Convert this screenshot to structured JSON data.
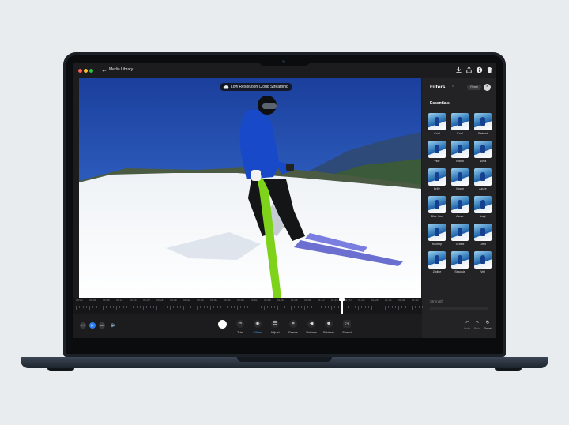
{
  "window": {
    "title": "Media Library"
  },
  "stream": {
    "label": "Low Resolution Cloud Streaming"
  },
  "filters_panel": {
    "title": "Filters",
    "reset_label": "Reset",
    "section": "Essentials",
    "strength_label": "Strength",
    "items": [
      "Cool",
      "Kool",
      "Retreat",
      "Vibe",
      "Island",
      "Nova",
      "Brille",
      "Vogue",
      "Azure",
      "Blue Hue",
      "Azure",
      "Lagi",
      "Rooftop",
      "Graffiti",
      "Orbit",
      "Zipline",
      "Sequoia",
      "Veil"
    ]
  },
  "timeline": {
    "ticks": [
      "00:00",
      "00:04",
      "00:08",
      "00:12",
      "00:16",
      "00:20",
      "00:24",
      "00:28",
      "00:32",
      "00:36",
      "00:40",
      "00:44",
      "00:48",
      "00:52",
      "00:56",
      "01:00",
      "01:04",
      "01:08",
      "01:12",
      "01:16",
      "01:20",
      "01:24",
      "01:28",
      "01:32",
      "01:36",
      "01:40"
    ]
  },
  "toolbar": {
    "tools": [
      {
        "label": "Trim",
        "icon": "scissors-icon"
      },
      {
        "label": "Filters",
        "icon": "filters-icon"
      },
      {
        "label": "Adjust",
        "icon": "sliders-icon"
      },
      {
        "label": "Frame",
        "icon": "frame-icon"
      },
      {
        "label": "Volume",
        "icon": "speaker-icon"
      },
      {
        "label": "Stickers",
        "icon": "sticker-icon"
      },
      {
        "label": "Speed",
        "icon": "speed-icon"
      }
    ],
    "undo_label": "Undo",
    "redo_label": "Redo",
    "reset_label": "Reset"
  },
  "colors": {
    "accent": "#3aa0ff",
    "panel": "#232325",
    "background": "#1c1c1e"
  }
}
